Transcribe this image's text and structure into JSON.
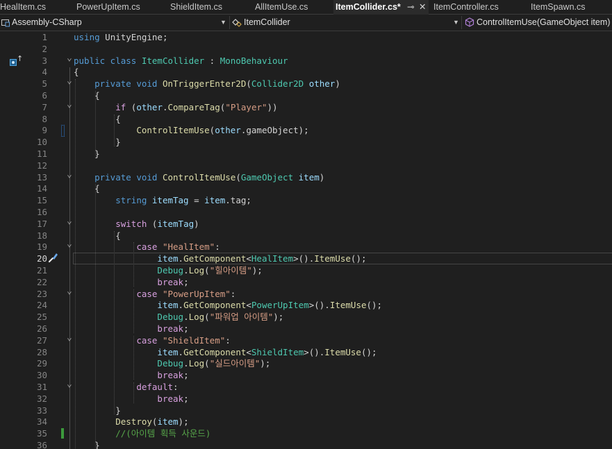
{
  "tabs": [
    {
      "label": "HealItem.cs",
      "active": false
    },
    {
      "label": "PowerUpItem.cs",
      "active": false
    },
    {
      "label": "ShieldItem.cs",
      "active": false
    },
    {
      "label": "AllItemUse.cs",
      "active": false
    },
    {
      "label": "ItemCollider.cs*",
      "active": true
    },
    {
      "label": "ItemController.cs",
      "active": false
    },
    {
      "label": "ItemSpawn.cs",
      "active": false
    }
  ],
  "tab_tools": {
    "pin_glyph": "⊸",
    "close_glyph": "✕"
  },
  "navbar": {
    "project": "Assembly-CSharp",
    "class": "ItemCollider",
    "member": "ControlItemUse(GameObject item)"
  },
  "editor": {
    "current_line": 20,
    "lines": [
      {
        "n": 1,
        "tokens": [
          [
            "kw",
            "using"
          ],
          [
            "pl",
            " UnityEngine;"
          ]
        ]
      },
      {
        "n": 2,
        "tokens": []
      },
      {
        "n": 3,
        "tokens": [
          [
            "kw",
            "public class "
          ],
          [
            "ty",
            "ItemCollider"
          ],
          [
            "pl",
            " : "
          ],
          [
            "ty",
            "MonoBehaviour"
          ]
        ]
      },
      {
        "n": 4,
        "tokens": [
          [
            "pl",
            "{"
          ]
        ]
      },
      {
        "n": 5,
        "tokens": [
          [
            "pl",
            "    "
          ],
          [
            "kw",
            "private void "
          ],
          [
            "mt",
            "OnTriggerEnter2D"
          ],
          [
            "pl",
            "("
          ],
          [
            "ty",
            "Collider2D"
          ],
          [
            "pl",
            " "
          ],
          [
            "pr",
            "other"
          ],
          [
            "pl",
            ")"
          ]
        ]
      },
      {
        "n": 6,
        "tokens": [
          [
            "pl",
            "    {"
          ]
        ]
      },
      {
        "n": 7,
        "tokens": [
          [
            "pl",
            "        "
          ],
          [
            "ct",
            "if"
          ],
          [
            "pl",
            " ("
          ],
          [
            "pr",
            "other"
          ],
          [
            "pl",
            "."
          ],
          [
            "mt",
            "CompareTag"
          ],
          [
            "pl",
            "("
          ],
          [
            "st",
            "\"Player\""
          ],
          [
            "pl",
            "))"
          ]
        ]
      },
      {
        "n": 8,
        "tokens": [
          [
            "pl",
            "        {"
          ]
        ]
      },
      {
        "n": 9,
        "tokens": [
          [
            "pl",
            "            "
          ],
          [
            "mt",
            "ControlItemUse"
          ],
          [
            "pl",
            "("
          ],
          [
            "pr",
            "other"
          ],
          [
            "pl",
            ".gameObject);"
          ]
        ]
      },
      {
        "n": 10,
        "tokens": [
          [
            "pl",
            "        }"
          ]
        ]
      },
      {
        "n": 11,
        "tokens": [
          [
            "pl",
            "    }"
          ]
        ]
      },
      {
        "n": 12,
        "tokens": []
      },
      {
        "n": 13,
        "tokens": [
          [
            "pl",
            "    "
          ],
          [
            "kw",
            "private void "
          ],
          [
            "mt",
            "ControlItemUse"
          ],
          [
            "pl",
            "("
          ],
          [
            "ty",
            "GameObject"
          ],
          [
            "pl",
            " "
          ],
          [
            "pr",
            "item"
          ],
          [
            "pl",
            ")"
          ]
        ]
      },
      {
        "n": 14,
        "tokens": [
          [
            "pl",
            "    {"
          ]
        ]
      },
      {
        "n": 15,
        "tokens": [
          [
            "pl",
            "        "
          ],
          [
            "kw",
            "string"
          ],
          [
            "pl",
            " "
          ],
          [
            "pr",
            "itemTag"
          ],
          [
            "pl",
            " = "
          ],
          [
            "pr",
            "item"
          ],
          [
            "pl",
            ".tag;"
          ]
        ]
      },
      {
        "n": 16,
        "tokens": []
      },
      {
        "n": 17,
        "tokens": [
          [
            "pl",
            "        "
          ],
          [
            "ct",
            "switch"
          ],
          [
            "pl",
            " ("
          ],
          [
            "pr",
            "itemTag"
          ],
          [
            "pl",
            ")"
          ]
        ]
      },
      {
        "n": 18,
        "tokens": [
          [
            "pl",
            "        {"
          ]
        ]
      },
      {
        "n": 19,
        "tokens": [
          [
            "pl",
            "            "
          ],
          [
            "ct",
            "case"
          ],
          [
            "pl",
            " "
          ],
          [
            "st",
            "\"HealItem\""
          ],
          [
            "pl",
            ":"
          ]
        ]
      },
      {
        "n": 20,
        "tokens": [
          [
            "pl",
            "                "
          ],
          [
            "pr",
            "item"
          ],
          [
            "pl",
            "."
          ],
          [
            "mt",
            "GetComponent"
          ],
          [
            "pl",
            "<"
          ],
          [
            "ty",
            "HealItem"
          ],
          [
            "pl",
            ">()."
          ],
          [
            "mt",
            "ItemUse"
          ],
          [
            "pl",
            "();"
          ]
        ]
      },
      {
        "n": 21,
        "tokens": [
          [
            "pl",
            "                "
          ],
          [
            "ty",
            "Debug"
          ],
          [
            "pl",
            "."
          ],
          [
            "mt",
            "Log"
          ],
          [
            "pl",
            "("
          ],
          [
            "st",
            "\"힐아이템\""
          ],
          [
            "pl",
            ");"
          ]
        ]
      },
      {
        "n": 22,
        "tokens": [
          [
            "pl",
            "                "
          ],
          [
            "ct",
            "break"
          ],
          [
            "pl",
            ";"
          ]
        ]
      },
      {
        "n": 23,
        "tokens": [
          [
            "pl",
            "            "
          ],
          [
            "ct",
            "case"
          ],
          [
            "pl",
            " "
          ],
          [
            "st",
            "\"PowerUpItem\""
          ],
          [
            "pl",
            ":"
          ]
        ]
      },
      {
        "n": 24,
        "tokens": [
          [
            "pl",
            "                "
          ],
          [
            "pr",
            "item"
          ],
          [
            "pl",
            "."
          ],
          [
            "mt",
            "GetComponent"
          ],
          [
            "pl",
            "<"
          ],
          [
            "ty",
            "PowerUpItem"
          ],
          [
            "pl",
            ">()."
          ],
          [
            "mt",
            "ItemUse"
          ],
          [
            "pl",
            "();"
          ]
        ]
      },
      {
        "n": 25,
        "tokens": [
          [
            "pl",
            "                "
          ],
          [
            "ty",
            "Debug"
          ],
          [
            "pl",
            "."
          ],
          [
            "mt",
            "Log"
          ],
          [
            "pl",
            "("
          ],
          [
            "st",
            "\"파워업 아이템\""
          ],
          [
            "pl",
            ");"
          ]
        ]
      },
      {
        "n": 26,
        "tokens": [
          [
            "pl",
            "                "
          ],
          [
            "ct",
            "break"
          ],
          [
            "pl",
            ";"
          ]
        ]
      },
      {
        "n": 27,
        "tokens": [
          [
            "pl",
            "            "
          ],
          [
            "ct",
            "case"
          ],
          [
            "pl",
            " "
          ],
          [
            "st",
            "\"ShieldItem\""
          ],
          [
            "pl",
            ":"
          ]
        ]
      },
      {
        "n": 28,
        "tokens": [
          [
            "pl",
            "                "
          ],
          [
            "pr",
            "item"
          ],
          [
            "pl",
            "."
          ],
          [
            "mt",
            "GetComponent"
          ],
          [
            "pl",
            "<"
          ],
          [
            "ty",
            "ShieldItem"
          ],
          [
            "pl",
            ">()."
          ],
          [
            "mt",
            "ItemUse"
          ],
          [
            "pl",
            "();"
          ]
        ]
      },
      {
        "n": 29,
        "tokens": [
          [
            "pl",
            "                "
          ],
          [
            "ty",
            "Debug"
          ],
          [
            "pl",
            "."
          ],
          [
            "mt",
            "Log"
          ],
          [
            "pl",
            "("
          ],
          [
            "st",
            "\"실드아이템\""
          ],
          [
            "pl",
            ");"
          ]
        ]
      },
      {
        "n": 30,
        "tokens": [
          [
            "pl",
            "                "
          ],
          [
            "ct",
            "break"
          ],
          [
            "pl",
            ";"
          ]
        ]
      },
      {
        "n": 31,
        "tokens": [
          [
            "pl",
            "            "
          ],
          [
            "ct",
            "default"
          ],
          [
            "pl",
            ":"
          ]
        ]
      },
      {
        "n": 32,
        "tokens": [
          [
            "pl",
            "                "
          ],
          [
            "ct",
            "break"
          ],
          [
            "pl",
            ";"
          ]
        ]
      },
      {
        "n": 33,
        "tokens": [
          [
            "pl",
            "        }"
          ]
        ]
      },
      {
        "n": 34,
        "tokens": [
          [
            "pl",
            "        "
          ],
          [
            "mt",
            "Destroy"
          ],
          [
            "pl",
            "("
          ],
          [
            "pr",
            "item"
          ],
          [
            "pl",
            ");"
          ]
        ]
      },
      {
        "n": 35,
        "tokens": [
          [
            "pl",
            "        "
          ],
          [
            "cm",
            "//(아이템 획득 사운드)"
          ]
        ]
      },
      {
        "n": 36,
        "tokens": [
          [
            "pl",
            "    }"
          ]
        ]
      }
    ],
    "fold_lines": [
      3,
      5,
      7,
      13,
      17,
      19,
      23,
      27,
      31
    ],
    "modified_lines": [
      {
        "n": 9,
        "color": "#2f7ed8"
      },
      {
        "n": 35,
        "color": "#3c9a3c"
      }
    ],
    "icons": [
      {
        "line": 3,
        "name": "implemented-member-icon",
        "glyph": "↑"
      },
      {
        "line": 20,
        "name": "quick-actions-brush-icon",
        "glyph": "✎"
      }
    ],
    "colors": {
      "keyword": "#569cd6",
      "type": "#4ec9b0",
      "method": "#dcdcaa",
      "string": "#d69d85",
      "parameter": "#9cdcfe",
      "comment": "#57a64a",
      "control": "#d8a0df",
      "active_tab_accent": "#b2a4f4"
    }
  }
}
